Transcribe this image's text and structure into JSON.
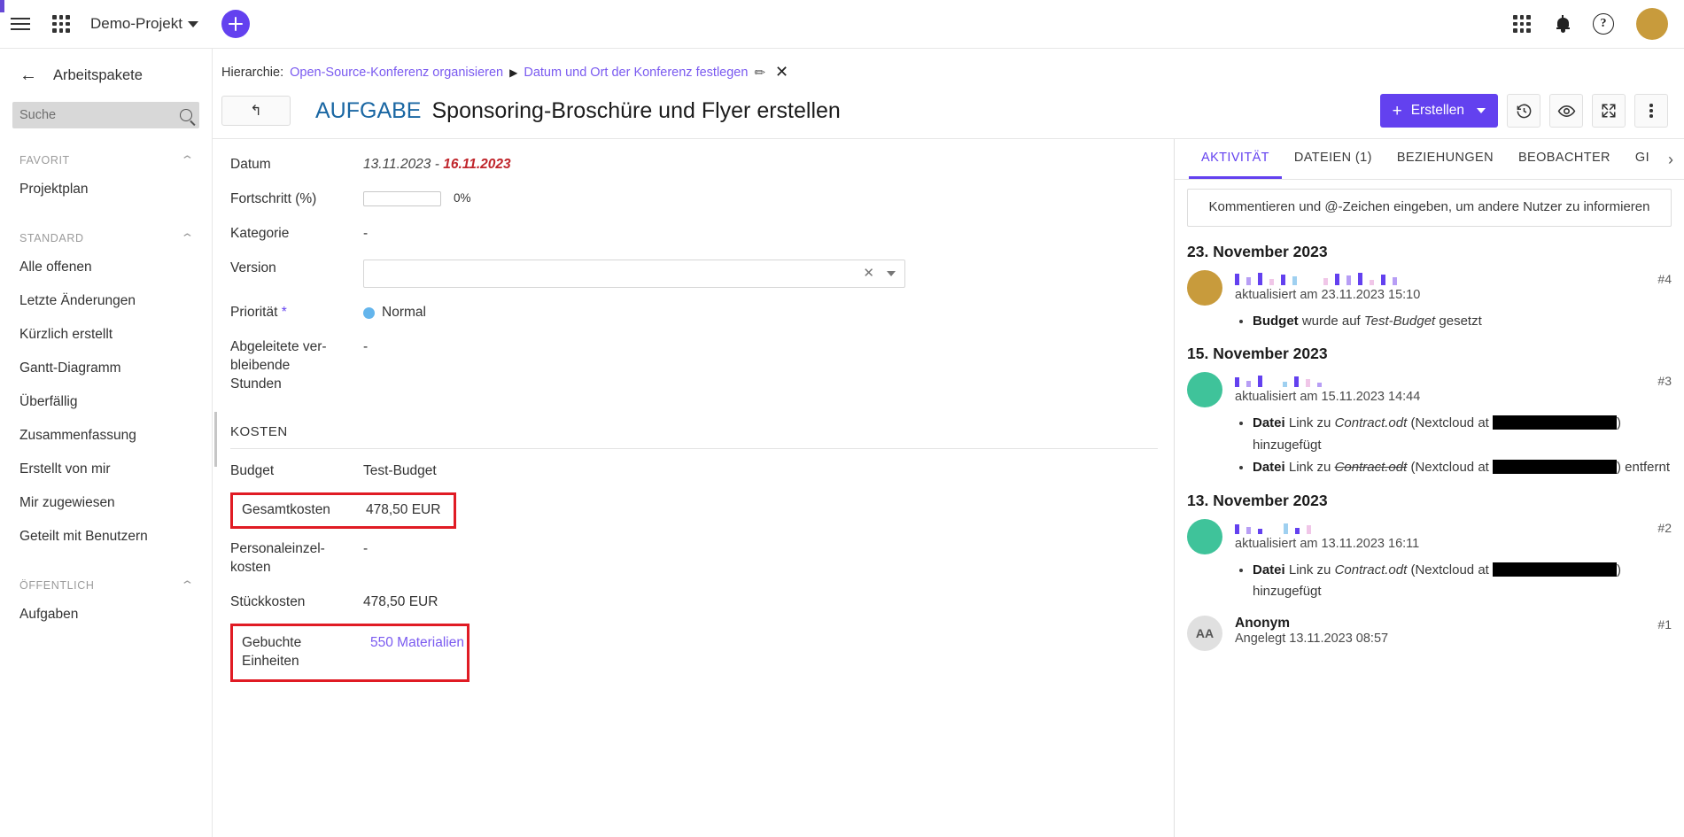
{
  "topbar": {
    "menu_icon": "hamburger-icon",
    "modules_icon": "grid-modules-icon",
    "project_name": "Demo-Projekt",
    "add_icon": "plus-icon",
    "apps_icon": "grid-apps-icon",
    "notifications_icon": "bell-icon",
    "help_label": "?",
    "avatar_color": "#C89B3C"
  },
  "sidebar": {
    "back_label": "←",
    "title": "Arbeitspakete",
    "search_placeholder": "Suche",
    "search_value": "",
    "groups": [
      {
        "label": "FAVORIT",
        "items": [
          "Projektplan"
        ]
      },
      {
        "label": "STANDARD",
        "items": [
          "Alle offenen",
          "Letzte Änderungen",
          "Kürzlich erstellt",
          "Gantt-Diagramm",
          "Überfällig",
          "Zusammenfassung",
          "Erstellt von mir",
          "Mir zugewiesen",
          "Geteilt mit Benutzern"
        ]
      },
      {
        "label": "ÖFFENTLICH",
        "items": [
          "Aufgaben"
        ]
      }
    ]
  },
  "breadcrumb": {
    "label": "Hierarchie:",
    "parent": "Open-Source-Konferenz organisieren",
    "separator": "▶",
    "current": "Datum und Ort der Konferenz festlegen",
    "edit_icon": "pencil-icon",
    "close_icon": "close-icon"
  },
  "work_package": {
    "back_icon": "back-arrow-icon",
    "type": "AUFGABE",
    "subject": "Sponsoring-Broschüre und Flyer erstellen"
  },
  "toolbar": {
    "create_label": "Erstellen",
    "create_plus": "+",
    "create_caret": "▾",
    "history_icon": "history-clock-icon",
    "watch_icon": "eye-icon",
    "fullscreen_icon": "fullscreen-icon",
    "more_icon": "more-vertical-icon"
  },
  "form": {
    "fields": [
      {
        "label": "Datum",
        "type": "date-range",
        "start": "13.11.2023",
        "dash": " - ",
        "end": "16.11.2023"
      },
      {
        "label": "Fortschritt (%)",
        "type": "progress",
        "percent": "0%",
        "value": 0
      },
      {
        "label": "Kategorie",
        "type": "text",
        "value": "-"
      },
      {
        "label": "Version",
        "type": "select",
        "value": "",
        "clear_icon": "clear-x-icon",
        "caret_icon": "chevron-down-icon"
      },
      {
        "label": "Priorität",
        "required": "*",
        "type": "priority",
        "value": "Normal",
        "color": "#64B5EC"
      },
      {
        "label": "Abgeleitete ver-\nbleibende\nStunden",
        "type": "text",
        "value": "-"
      }
    ],
    "costs_section": "KOSTEN",
    "cost_fields": [
      {
        "label": "Budget",
        "value": "Test-Budget",
        "highlighted": false,
        "link": false
      },
      {
        "label": "Gesamtkosten",
        "value": "478,50 EUR",
        "highlighted": true,
        "link": false
      },
      {
        "label": "Personaleinzel-\nkosten",
        "value": "-",
        "highlighted": false,
        "link": false
      },
      {
        "label": "Stückkosten",
        "value": "478,50 EUR",
        "highlighted": false,
        "link": false
      },
      {
        "label": "Gebuchte\nEinheiten",
        "value": "550 Materialien",
        "highlighted": true,
        "link": true
      }
    ]
  },
  "activity": {
    "tabs": [
      {
        "label": "AKTIVITÄT",
        "active": true
      },
      {
        "label": "DATEIEN (1)",
        "active": false
      },
      {
        "label": "BEZIEHUNGEN",
        "active": false
      },
      {
        "label": "BEOBACHTER",
        "active": false
      },
      {
        "label": "GI",
        "active": false
      }
    ],
    "next_icon": "chevron-right-icon",
    "comment_placeholder": "Kommentieren und @-Zeichen eingeben, um andere Nutzer zu informieren",
    "groups": [
      {
        "date": "23. November 2023",
        "entries": [
          {
            "avatar_color": "#C89B3C",
            "avatar_initials": "",
            "name_redacted": true,
            "name": "",
            "subtitle": "aktualisiert am 23.11.2023 15:10",
            "number": "#4",
            "changes": [
              {
                "bold": "Budget",
                "text": " wurde auf ",
                "italic": "Test-Budget",
                "tail": " gesetzt"
              }
            ]
          }
        ]
      },
      {
        "date": "15. November 2023",
        "entries": [
          {
            "avatar_color": "#3FC39A",
            "avatar_initials": "",
            "name_redacted": true,
            "name": "",
            "subtitle": "aktualisiert am 15.11.2023 14:44",
            "number": "#3",
            "changes": [
              {
                "bold": "Datei",
                "text": " Link zu ",
                "italic": "Contract.odt",
                "tail": " (Nextcloud at ",
                "redacted": true,
                "end": ") hinzugefügt"
              },
              {
                "bold": "Datei",
                "text": " Link zu ",
                "italic": "Contract.odt",
                "struck": true,
                "tail": " (Nextcloud at ",
                "redacted": true,
                "end": ") entfernt"
              }
            ]
          }
        ]
      },
      {
        "date": "13. November 2023",
        "entries": [
          {
            "avatar_color": "#3FC39A",
            "avatar_initials": "",
            "name_redacted": true,
            "name": "",
            "subtitle": "aktualisiert am 13.11.2023 16:11",
            "number": "#2",
            "changes": [
              {
                "bold": "Datei",
                "text": " Link zu ",
                "italic": "Contract.odt",
                "tail": " (Nextcloud at ",
                "redacted": true,
                "end": ") hinzugefügt"
              }
            ]
          },
          {
            "avatar_color": "#e0e0e0",
            "avatar_initials": "AA",
            "name_redacted": false,
            "name": "Anonym",
            "subtitle": "Angelegt 13.11.2023 08:57",
            "number": "#1",
            "changes": []
          }
        ]
      }
    ]
  },
  "colors": {
    "accent": "#6341EF",
    "link": "#7A5AF0",
    "type_blue": "#1A67A3",
    "highlight_red": "#E01B24",
    "date_overdue": "#C0262C"
  }
}
